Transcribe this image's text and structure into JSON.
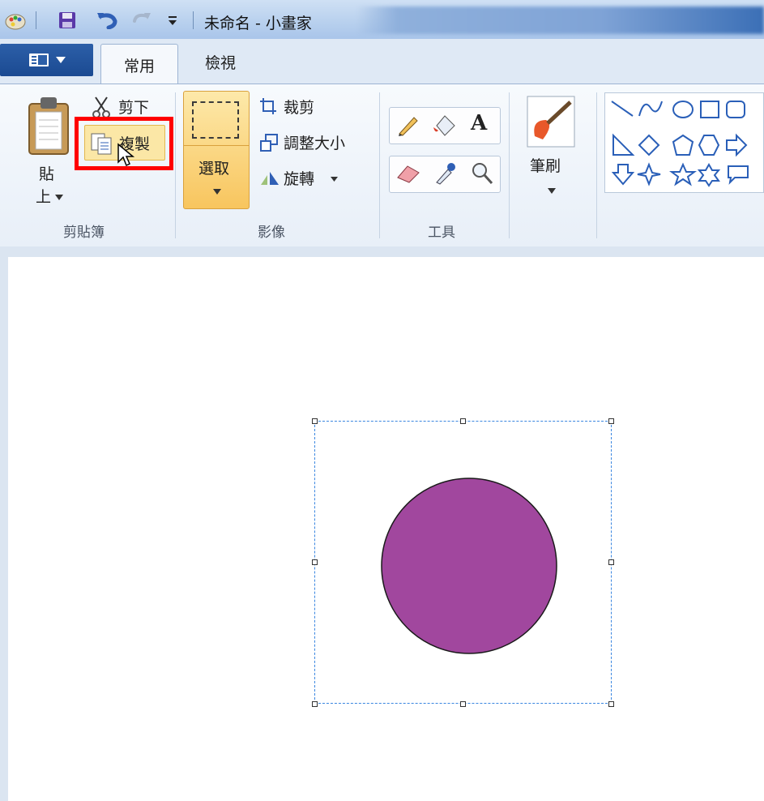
{
  "window": {
    "title": "未命名 - 小畫家"
  },
  "tabs": {
    "home": "常用",
    "view": "檢視"
  },
  "clipboard": {
    "paste_top": "貼",
    "paste_bottom": "上",
    "cut": "剪下",
    "copy": "複製",
    "group_label": "剪貼簿"
  },
  "image": {
    "select": "選取",
    "crop": "裁剪",
    "resize": "調整大小",
    "rotate": "旋轉",
    "group_label": "影像"
  },
  "tools": {
    "group_label": "工具"
  },
  "brushes": {
    "label": "筆刷"
  },
  "canvas": {
    "circle_fill": "#a1479e",
    "selection_color": "#3a86e0"
  },
  "colors": {
    "highlight_box": "#ff0000",
    "active_button": "#fbd680"
  }
}
